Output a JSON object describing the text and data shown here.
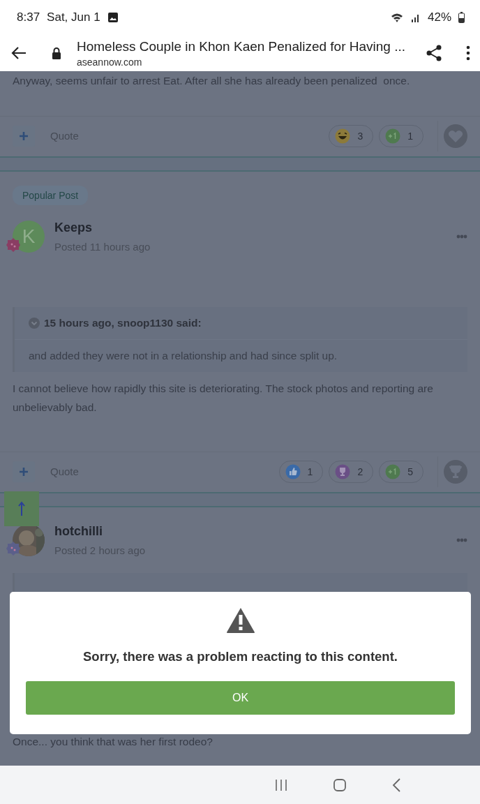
{
  "status_bar": {
    "time": "8:37",
    "date": "Sat, Jun 1",
    "battery": "42%"
  },
  "browser": {
    "title": "Homeless Couple in Khon Kaen Penalized for Having ...",
    "domain": "aseannow.com"
  },
  "posts": [
    {
      "body": "Anyway, seems unfair to arrest Eat. After all she has already been penalized  once.",
      "quote_label": "Quote",
      "reactions": [
        {
          "kind": "laugh",
          "count": "3"
        },
        {
          "kind": "plus-one",
          "count": "1"
        }
      ],
      "react_button": {
        "kind": "heart"
      }
    },
    {
      "badge": "Popular Post",
      "author": "Keeps",
      "posted": "Posted 11 hours ago",
      "avatar": {
        "kind": "letter",
        "letter": "K"
      },
      "quote": {
        "header": "15 hours ago, snoop1130 said:",
        "text": "and added they were not in a relationship and had since split up."
      },
      "body": "I cannot believe how rapidly this site is deteriorating. The stock photos and reporting are unbelievably bad.",
      "quote_label": "Quote",
      "reactions": [
        {
          "kind": "like",
          "count": "1"
        },
        {
          "kind": "trophy",
          "count": "2"
        },
        {
          "kind": "plus-one",
          "count": "5"
        }
      ],
      "react_button": {
        "kind": "trophy"
      }
    },
    {
      "author": "hotchilli",
      "posted": "Posted 2 hours ago",
      "body": "Once... you think that was her first rodeo?"
    }
  ],
  "dialog": {
    "message": "Sorry, there was a problem reacting to this content.",
    "button": "OK"
  }
}
